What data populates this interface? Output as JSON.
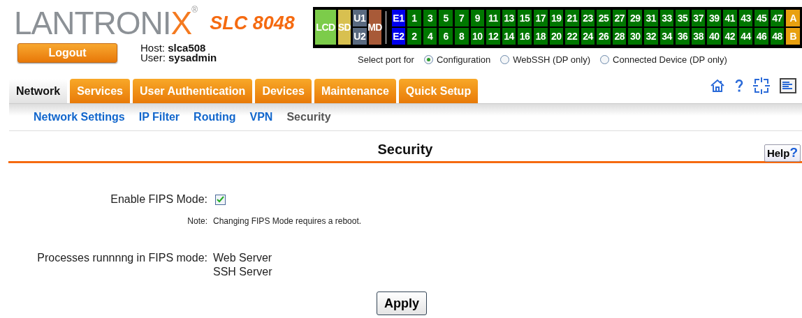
{
  "header": {
    "logo": {
      "text": "LANTRONI",
      "accent": "X",
      "mark": "®"
    },
    "model": "SLC 8048",
    "logout_button": "Logout",
    "host_label": "Host:",
    "host": "slca508",
    "user_label": "User:",
    "user": "sysadmin"
  },
  "port_panel": {
    "groups": [
      {
        "kind": "single",
        "label": "LCD",
        "color": "#7ccc4a"
      },
      {
        "kind": "single",
        "label": "SD",
        "color": "#d8c050"
      },
      {
        "kind": "stack",
        "cells": [
          {
            "label": "U1",
            "color": "#5a6a80"
          },
          {
            "label": "U2",
            "color": "#5a6a80"
          }
        ]
      },
      {
        "kind": "single",
        "label": "MD",
        "color": "#a85a38"
      },
      {
        "kind": "separator"
      },
      {
        "kind": "stack",
        "cells": [
          {
            "label": "E1",
            "color": "#0000ee"
          },
          {
            "label": "E2",
            "color": "#0000ee"
          }
        ]
      },
      {
        "kind": "stack",
        "cells": [
          {
            "label": "1",
            "color": "#007700"
          },
          {
            "label": "2",
            "color": "#007700"
          }
        ]
      },
      {
        "kind": "stack",
        "cells": [
          {
            "label": "3",
            "color": "#007700"
          },
          {
            "label": "4",
            "color": "#007700"
          }
        ]
      },
      {
        "kind": "stack",
        "cells": [
          {
            "label": "5",
            "color": "#007700"
          },
          {
            "label": "6",
            "color": "#007700"
          }
        ]
      },
      {
        "kind": "stack",
        "cells": [
          {
            "label": "7",
            "color": "#007700"
          },
          {
            "label": "8",
            "color": "#007700"
          }
        ]
      },
      {
        "kind": "stack",
        "cells": [
          {
            "label": "9",
            "color": "#007700"
          },
          {
            "label": "10",
            "color": "#007700"
          }
        ]
      },
      {
        "kind": "stack",
        "cells": [
          {
            "label": "11",
            "color": "#007700"
          },
          {
            "label": "12",
            "color": "#007700"
          }
        ]
      },
      {
        "kind": "stack",
        "cells": [
          {
            "label": "13",
            "color": "#007700"
          },
          {
            "label": "14",
            "color": "#007700"
          }
        ]
      },
      {
        "kind": "stack",
        "cells": [
          {
            "label": "15",
            "color": "#007700"
          },
          {
            "label": "16",
            "color": "#007700"
          }
        ]
      },
      {
        "kind": "stack",
        "cells": [
          {
            "label": "17",
            "color": "#007700"
          },
          {
            "label": "18",
            "color": "#007700"
          }
        ]
      },
      {
        "kind": "stack",
        "cells": [
          {
            "label": "19",
            "color": "#007700"
          },
          {
            "label": "20",
            "color": "#007700"
          }
        ]
      },
      {
        "kind": "stack",
        "cells": [
          {
            "label": "21",
            "color": "#007700"
          },
          {
            "label": "22",
            "color": "#007700"
          }
        ]
      },
      {
        "kind": "stack",
        "cells": [
          {
            "label": "23",
            "color": "#007700"
          },
          {
            "label": "24",
            "color": "#007700"
          }
        ]
      },
      {
        "kind": "stack",
        "cells": [
          {
            "label": "25",
            "color": "#007700"
          },
          {
            "label": "26",
            "color": "#007700"
          }
        ]
      },
      {
        "kind": "stack",
        "cells": [
          {
            "label": "27",
            "color": "#007700"
          },
          {
            "label": "28",
            "color": "#007700"
          }
        ]
      },
      {
        "kind": "stack",
        "cells": [
          {
            "label": "29",
            "color": "#007700"
          },
          {
            "label": "30",
            "color": "#007700"
          }
        ]
      },
      {
        "kind": "stack",
        "cells": [
          {
            "label": "31",
            "color": "#007700"
          },
          {
            "label": "32",
            "color": "#007700"
          }
        ]
      },
      {
        "kind": "stack",
        "cells": [
          {
            "label": "33",
            "color": "#007700"
          },
          {
            "label": "34",
            "color": "#007700"
          }
        ]
      },
      {
        "kind": "stack",
        "cells": [
          {
            "label": "35",
            "color": "#007700"
          },
          {
            "label": "36",
            "color": "#007700"
          }
        ]
      },
      {
        "kind": "stack",
        "cells": [
          {
            "label": "37",
            "color": "#007700"
          },
          {
            "label": "38",
            "color": "#007700"
          }
        ]
      },
      {
        "kind": "stack",
        "cells": [
          {
            "label": "39",
            "color": "#007700"
          },
          {
            "label": "40",
            "color": "#007700"
          }
        ]
      },
      {
        "kind": "stack",
        "cells": [
          {
            "label": "41",
            "color": "#007700"
          },
          {
            "label": "42",
            "color": "#007700"
          }
        ]
      },
      {
        "kind": "stack",
        "cells": [
          {
            "label": "43",
            "color": "#007700"
          },
          {
            "label": "44",
            "color": "#007700"
          }
        ]
      },
      {
        "kind": "stack",
        "cells": [
          {
            "label": "45",
            "color": "#007700"
          },
          {
            "label": "46",
            "color": "#007700"
          }
        ]
      },
      {
        "kind": "stack",
        "cells": [
          {
            "label": "47",
            "color": "#007700"
          },
          {
            "label": "48",
            "color": "#007700"
          }
        ]
      },
      {
        "kind": "stack",
        "cells": [
          {
            "label": "A",
            "color": "#e8a010"
          },
          {
            "label": "B",
            "color": "#e8a010"
          }
        ]
      }
    ]
  },
  "port_select": {
    "label": "Select port for",
    "options": [
      {
        "label": "Configuration",
        "selected": true
      },
      {
        "label": "WebSSH (DP only)",
        "selected": false
      },
      {
        "label": "Connected Device (DP only)",
        "selected": false
      }
    ]
  },
  "tabs": [
    {
      "label": "Network",
      "selected": true
    },
    {
      "label": "Services",
      "selected": false
    },
    {
      "label": "User Authentication",
      "selected": false
    },
    {
      "label": "Devices",
      "selected": false
    },
    {
      "label": "Maintenance",
      "selected": false
    },
    {
      "label": "Quick Setup",
      "selected": false
    }
  ],
  "subnav": [
    {
      "label": "Network Settings",
      "selected": false
    },
    {
      "label": "IP Filter",
      "selected": false
    },
    {
      "label": "Routing",
      "selected": false
    },
    {
      "label": "VPN",
      "selected": false
    },
    {
      "label": "Security",
      "selected": true
    }
  ],
  "page": {
    "title": "Security",
    "help_button": "Help",
    "help_mark": "?"
  },
  "form": {
    "fips": {
      "label": "Enable FIPS Mode:",
      "checked": true
    },
    "note": {
      "label": "Note:",
      "text": "Changing FIPS Mode requires a reboot."
    },
    "processes": {
      "label": "Processes runnnng in FIPS mode:",
      "values": [
        "Web Server",
        "SSH Server"
      ]
    }
  },
  "apply_button": "Apply"
}
